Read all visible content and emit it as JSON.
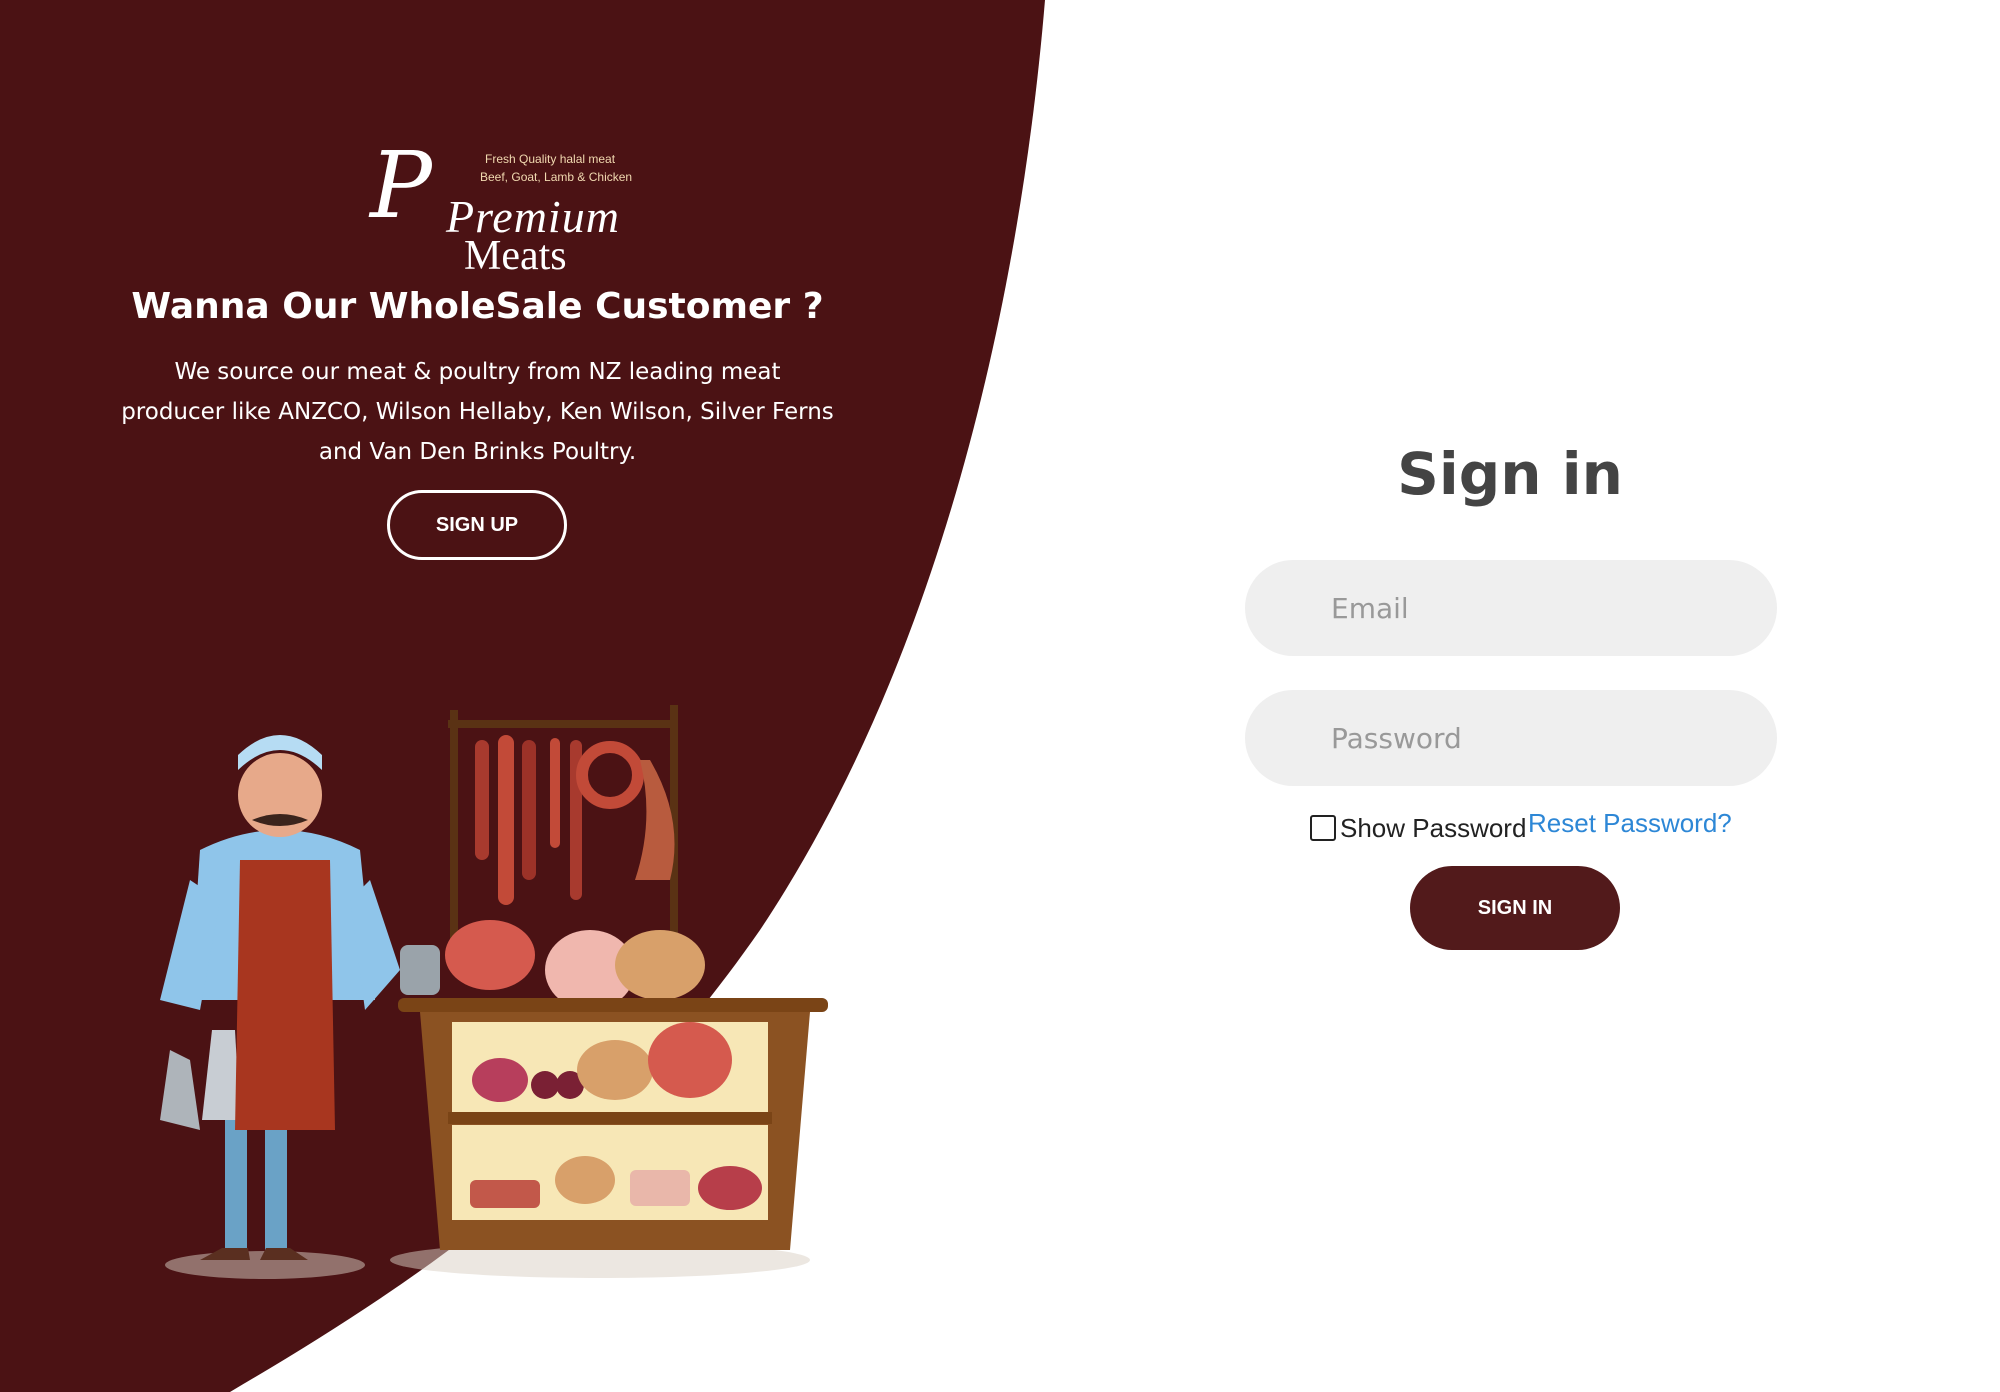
{
  "brand": {
    "script_initial": "P",
    "name_line1": "Premium",
    "name_line2": "Meats",
    "tagline_line1": "Fresh Quality halal meat",
    "tagline_line2": "Beef, Goat, Lamb & Chicken"
  },
  "left_panel": {
    "headline": "Wanna Our WholeSale Customer ?",
    "description": "We source our meat & poultry from NZ leading meat producer like ANZCO, Wilson Hellaby, Ken Wilson, Silver Ferns and Van Den Brinks Poultry.",
    "signup_label": "SIGN UP",
    "illustration_icon": "butcher-shop-illustration"
  },
  "signin": {
    "title": "Sign in",
    "email_placeholder": "Email",
    "email_value": "",
    "password_placeholder": "Password",
    "password_value": "",
    "show_password_label": "Show Password",
    "show_password_checked": false,
    "reset_link_label": "Reset Password?",
    "signin_label": "SIGN IN"
  },
  "colors": {
    "primary_maroon": "#521a1b",
    "panel_bg": "#4b1214",
    "link_blue": "#2d87d6",
    "field_bg": "#efefef"
  }
}
